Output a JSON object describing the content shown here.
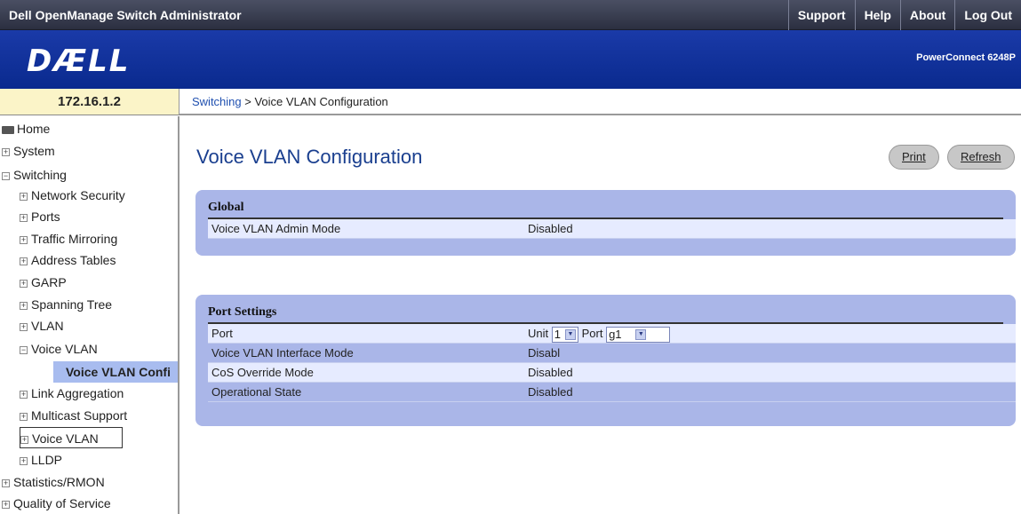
{
  "topbar": {
    "title": "Dell OpenManage Switch Administrator",
    "links": [
      "Support",
      "Help",
      "About",
      "Log Out"
    ]
  },
  "banner": {
    "logo": "DÆLL",
    "product": "PowerConnect 6248P"
  },
  "ip": "172.16.1.2",
  "breadcrumb": {
    "link": "Switching",
    "separator": " > ",
    "current": "Voice VLAN Configuration"
  },
  "sidebar": {
    "items": [
      {
        "label": "Home"
      },
      {
        "label": "System"
      },
      {
        "label": "Switching"
      },
      {
        "label": "Network Security"
      },
      {
        "label": "Ports"
      },
      {
        "label": "Traffic Mirroring"
      },
      {
        "label": "Address Tables"
      },
      {
        "label": "GARP"
      },
      {
        "label": "Spanning Tree"
      },
      {
        "label": "VLAN"
      },
      {
        "label": "Voice VLAN"
      },
      {
        "label": "Voice VLAN Confi"
      },
      {
        "label": "Link Aggregation"
      },
      {
        "label": "Multicast Support"
      },
      {
        "label": "Voice VLAN"
      },
      {
        "label": "LLDP"
      },
      {
        "label": "Statistics/RMON"
      },
      {
        "label": "Quality of Service"
      }
    ]
  },
  "main": {
    "title": "Voice VLAN Configuration",
    "print_label": "Print",
    "refresh_label": "Refresh",
    "global": {
      "title": "Global",
      "admin_mode_label": "Voice VLAN Admin Mode",
      "admin_mode_value": "Disabled"
    },
    "port_settings": {
      "title": "Port Settings",
      "port_label": "Port",
      "unit_label": "Unit",
      "unit_value": "1",
      "port_field_label": "Port",
      "port_value": "g1",
      "interface_mode_label": "Voice VLAN Interface Mode",
      "interface_mode_value": "Disabl",
      "cos_label": "CoS Override Mode",
      "cos_value": "Disabled",
      "op_state_label": "Operational State",
      "op_state_value": "Disabled"
    }
  }
}
